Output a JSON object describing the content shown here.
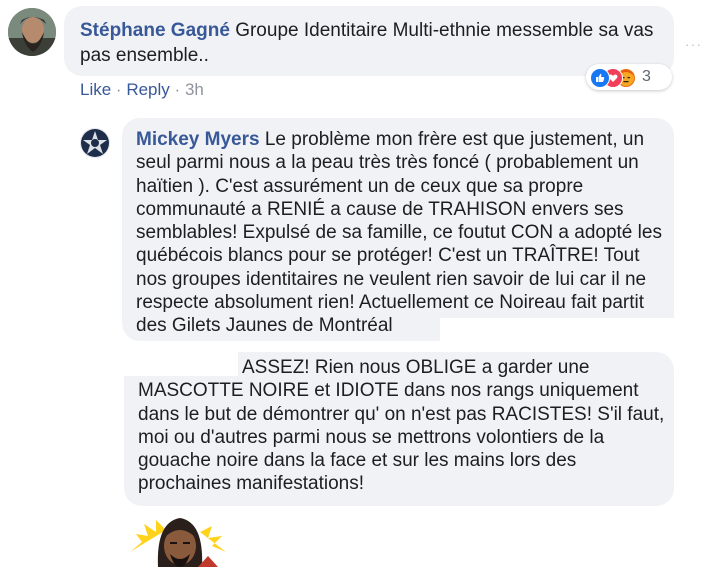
{
  "comment": {
    "author": "Stéphane Gagné",
    "text": "Groupe Identitaire Multi-ethnie messemble sa vas pas ensemble..",
    "actions": {
      "like": "Like",
      "reply": "Reply",
      "time": "3h",
      "separator": "·"
    },
    "reactions": {
      "count": "3",
      "types": [
        "like-icon",
        "love-icon",
        "angry-icon"
      ]
    },
    "menu_glyph": "···"
  },
  "reply": {
    "author": "Mickey Myers",
    "text": "Le problème mon frère est que justement, un seul parmi nous a la peau très très foncé ( probablement un haïtien ). C'est assurément un de ceux que sa propre communauté a RENIÉ a cause de TRAHISON envers ses semblables! Expulsé de sa famille, ce foutut CON a adopté les québécois blancs pour se protéger! C'est un TRAÎTRE! Tout nos groupes identitaires ne veulent rien savoir de lui car il ne respecte absolument rien! Actuellement ce Noireau fait partit des Gilets Jaunes de Montréal",
    "continuation": "ASSEZ! Rien nous OBLIGE a garder une MASCOTTE NOIRE et IDIOTE dans nos rangs uniquement dans le but de démontrer qu' on n'est pas RACISTES! S'il faut, moi ou d'autres parmi nous se mettrons volontiers de la gouache noire dans la face et sur les mains lors des prochaines manifestations!"
  },
  "colors": {
    "name": "#385898",
    "bubble": "#f0f2f5",
    "meta": "#90949c"
  }
}
